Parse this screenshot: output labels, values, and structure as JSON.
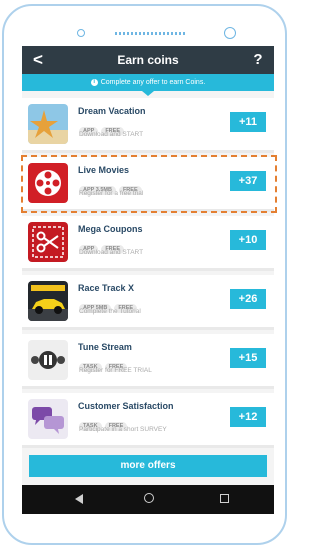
{
  "header": {
    "back_icon": "chevron-left-icon",
    "back_glyph": "<",
    "title": "Earn coins",
    "help_glyph": "?"
  },
  "info_banner": {
    "icon": "info-icon",
    "icon_glyph": "i",
    "text": "Complete any offer to earn Coins."
  },
  "offers": [
    {
      "name": "Dream Vacation",
      "tags": [
        "APP",
        "FREE"
      ],
      "subtitle": "Download and START",
      "reward": "+11",
      "icon": "starfish-icon"
    },
    {
      "name": "Live Movies",
      "tags": [
        "APP 3.5MB",
        "FREE"
      ],
      "subtitle": "Register for a free trial",
      "reward": "+37",
      "icon": "film-reel-icon"
    },
    {
      "name": "Mega Coupons",
      "tags": [
        "APP",
        "FREE"
      ],
      "subtitle": "Download and START",
      "reward": "+10",
      "icon": "scissors-icon"
    },
    {
      "name": "Race Track X",
      "tags": [
        "APP 5MB",
        "FREE"
      ],
      "subtitle": "Complete the Tutorial",
      "reward": "+26",
      "icon": "race-car-icon"
    },
    {
      "name": "Tune Stream",
      "tags": [
        "TASK",
        "FREE"
      ],
      "subtitle": "Register for FREE TRIAL",
      "reward": "+15",
      "icon": "music-player-icon"
    },
    {
      "name": "Customer Satisfaction",
      "tags": [
        "TASK",
        "FREE"
      ],
      "subtitle": "Participate in a short SURVEY",
      "reward": "+12",
      "icon": "speech-bubble-icon"
    }
  ],
  "more_button": {
    "label": "more offers"
  },
  "colors": {
    "accent": "#27b9da",
    "header": "#2f3c45",
    "highlight": "#e47f31"
  }
}
